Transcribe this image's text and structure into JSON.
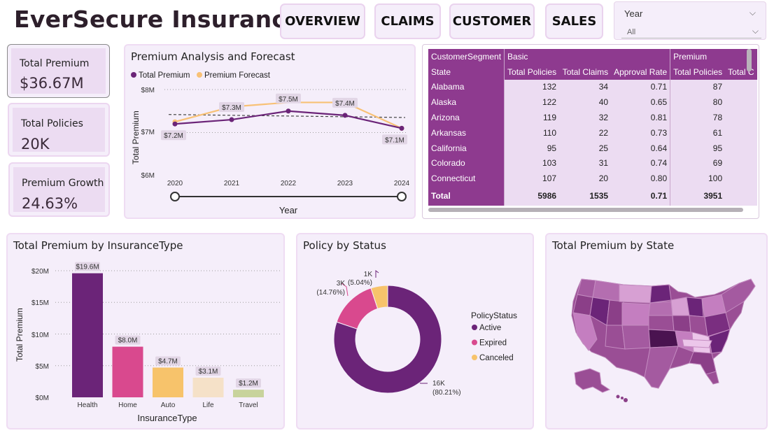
{
  "app": {
    "title": "EverSecure Insurance"
  },
  "nav": {
    "overview": "OVERVIEW",
    "claims": "CLAIMS",
    "customer": "CUSTOMER",
    "sales": "SALES"
  },
  "year_slicer": {
    "label": "Year",
    "value": "All"
  },
  "kpis": [
    {
      "label": "Total Premium",
      "value": "$36.67M"
    },
    {
      "label": "Total Policies",
      "value": "20K"
    },
    {
      "label": "Premium Growth",
      "value": "24.63%"
    }
  ],
  "premium_analysis": {
    "title": "Premium Analysis and Forecast",
    "legend": [
      "Total Premium",
      "Premium Forecast"
    ],
    "xlabel": "Year",
    "ylabel": "Total Premium",
    "yticks": [
      "$8M",
      "$7M",
      "$6M"
    ],
    "xticks": [
      "2020",
      "2021",
      "2022",
      "2023",
      "2024"
    ],
    "data_labels": [
      "$7.2M",
      "$7.3M",
      "$7.5M",
      "$7.4M",
      "$7.1M",
      "$7.3M",
      "$7.2M",
      "$7.2M"
    ]
  },
  "table": {
    "group_headers": [
      "CustomerSegment",
      "Basic",
      "Premium"
    ],
    "columns": [
      "State",
      "Total Policies",
      "Total Claims",
      "Approval Rate",
      "Total Policies",
      "Total C"
    ],
    "rows": [
      [
        "Alabama",
        "132",
        "34",
        "0.71",
        "87",
        ""
      ],
      [
        "Alaska",
        "122",
        "40",
        "0.65",
        "80",
        ""
      ],
      [
        "Arizona",
        "119",
        "32",
        "0.81",
        "78",
        ""
      ],
      [
        "Arkansas",
        "110",
        "22",
        "0.73",
        "61",
        ""
      ],
      [
        "California",
        "95",
        "25",
        "0.64",
        "95",
        ""
      ],
      [
        "Colorado",
        "103",
        "31",
        "0.74",
        "69",
        ""
      ],
      [
        "Connecticut",
        "107",
        "20",
        "0.80",
        "100",
        ""
      ]
    ],
    "total": [
      "Total",
      "5986",
      "1535",
      "0.71",
      "3951",
      ""
    ]
  },
  "insurance_type": {
    "title": "Total Premium by InsuranceType",
    "xlabel": "InsuranceType",
    "ylabel": "Total Premium",
    "yticks": [
      "$20M",
      "$15M",
      "$10M",
      "$5M",
      "$0M"
    ]
  },
  "policy_status": {
    "title": "Policy by Status",
    "legend_title": "PolicyStatus",
    "labels": {
      "active_count": "16K",
      "active_pct": "(80.21%)",
      "expired_count": "3K",
      "expired_pct": "(14.76%)",
      "canceled_count": "1K",
      "canceled_pct": "(5.04%)"
    }
  },
  "state_map": {
    "title": "Total Premium by State"
  },
  "colors": {
    "purple": "#6b2478",
    "pink": "#d9498e",
    "orange": "#f7c36b",
    "cream": "#f5e1c8",
    "sage": "#c8d39c",
    "forecast": "#f8c176"
  },
  "chart_data": [
    {
      "type": "line",
      "title": "Premium Analysis and Forecast",
      "xlabel": "Year",
      "ylabel": "Total Premium",
      "x": [
        2020,
        2021,
        2022,
        2023,
        2024
      ],
      "ylim": [
        6,
        8
      ],
      "series": [
        {
          "name": "Total Premium",
          "values": [
            7.2,
            7.3,
            7.5,
            7.4,
            7.1
          ]
        },
        {
          "name": "Premium Forecast",
          "values": [
            7.25,
            7.6,
            7.7,
            7.7,
            7.1
          ]
        }
      ],
      "trend_line": [
        7.42,
        7.35
      ],
      "data_labels": [
        {
          "x": 2020,
          "y": 7.2,
          "text": "$7.2M"
        },
        {
          "x": 2021,
          "y": 7.3,
          "text": "$7.3M"
        },
        {
          "x": 2022,
          "y": 7.5,
          "text": "$7.5M"
        },
        {
          "x": 2023,
          "y": 7.4,
          "text": "$7.4M"
        },
        {
          "x": 2024,
          "y": 7.1,
          "text": "$7.1M"
        }
      ],
      "legend_placement": "top-left",
      "grid": true
    },
    {
      "type": "bar",
      "title": "Total Premium by InsuranceType",
      "xlabel": "InsuranceType",
      "ylabel": "Total Premium",
      "categories": [
        "Health",
        "Home",
        "Auto",
        "Life",
        "Travel"
      ],
      "values": [
        19.6,
        8.0,
        4.7,
        3.1,
        1.2
      ],
      "labels": [
        "$19.6M",
        "$8.0M",
        "$4.7M",
        "$3.1M",
        "$1.2M"
      ],
      "colors": [
        "#6b2478",
        "#d9498e",
        "#f7c36b",
        "#f5e1c8",
        "#c8d39c"
      ],
      "ylim": [
        0,
        22
      ],
      "grid": true
    },
    {
      "type": "pie",
      "title": "Policy by Status",
      "categories": [
        "Active",
        "Expired",
        "Canceled"
      ],
      "values": [
        80.21,
        14.76,
        5.04
      ],
      "colors": [
        "#6b2478",
        "#d9498e",
        "#f7c36b"
      ],
      "legend_placement": "right"
    }
  ]
}
